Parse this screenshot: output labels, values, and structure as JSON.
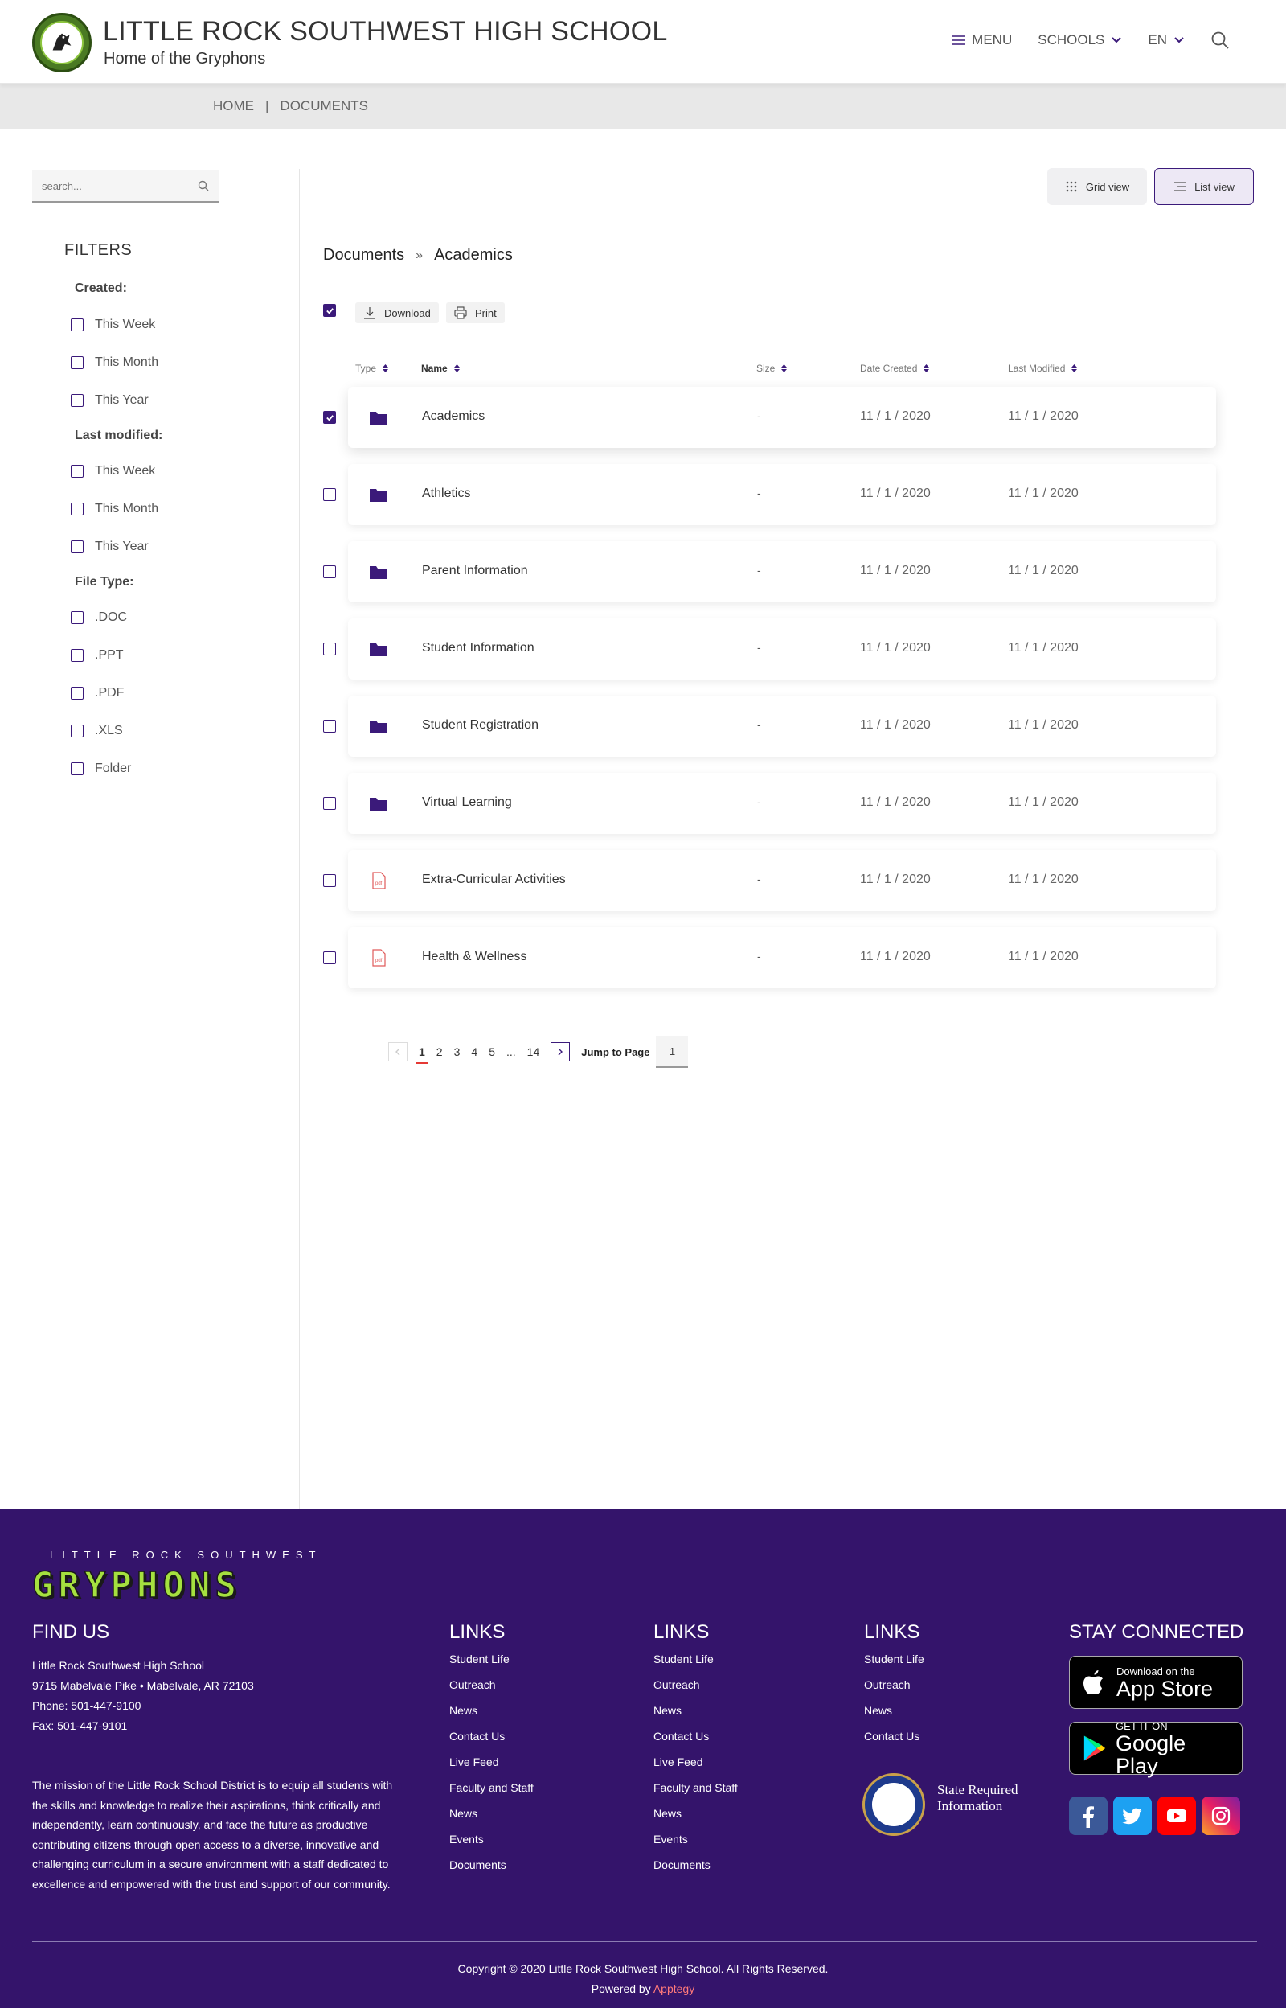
{
  "header": {
    "school_name": "LITTLE ROCK SOUTHWEST HIGH SCHOOL",
    "tagline": "Home of the Gryphons",
    "nav": {
      "menu": "MENU",
      "schools": "SCHOOLS",
      "language": "EN"
    }
  },
  "breadcrumb": {
    "home": "HOME",
    "separator": "|",
    "current": "DOCUMENTS"
  },
  "sidebar": {
    "search_placeholder": "search...",
    "filters_title": "FILTERS",
    "created": {
      "label": "Created:",
      "options": [
        "This Week",
        "This Month",
        "This Year"
      ]
    },
    "last_modified": {
      "label": "Last modified:",
      "options": [
        "This Week",
        "This Month",
        "This Year"
      ]
    },
    "file_type": {
      "label": "File Type:",
      "options": [
        ".DOC",
        ".PPT",
        ".PDF",
        ".XLS",
        "Folder"
      ]
    }
  },
  "views": {
    "grid": "Grid view",
    "list": "List view",
    "active": "list"
  },
  "doc_breadcrumb": {
    "root": "Documents",
    "separator": "»",
    "current": "Academics"
  },
  "actions": {
    "download": "Download",
    "print": "Print"
  },
  "table": {
    "headers": {
      "type": "Type",
      "name": "Name",
      "size": "Size",
      "created": "Date Created",
      "modified": "Last Modified"
    },
    "rows": [
      {
        "type": "folder",
        "name": "Academics",
        "size": "-",
        "created": "11 / 1 / 2020",
        "modified": "11 / 1 / 2020",
        "checked": true
      },
      {
        "type": "folder",
        "name": "Athletics",
        "size": "-",
        "created": "11 / 1 / 2020",
        "modified": "11 / 1 / 2020",
        "checked": false
      },
      {
        "type": "folder",
        "name": "Parent Information",
        "size": "-",
        "created": "11 / 1 / 2020",
        "modified": "11 / 1 / 2020",
        "checked": false
      },
      {
        "type": "folder",
        "name": "Student Information",
        "size": "-",
        "created": "11 / 1 / 2020",
        "modified": "11 / 1 / 2020",
        "checked": false
      },
      {
        "type": "folder",
        "name": "Student Registration",
        "size": "-",
        "created": "11 / 1 / 2020",
        "modified": "11 / 1 / 2020",
        "checked": false
      },
      {
        "type": "folder",
        "name": "Virtual Learning",
        "size": "-",
        "created": "11 / 1 / 2020",
        "modified": "11 / 1 / 2020",
        "checked": false
      },
      {
        "type": "pdf",
        "name": "Extra-Curricular Activities",
        "size": "-",
        "created": "11 / 1 / 2020",
        "modified": "11 / 1 / 2020",
        "checked": false
      },
      {
        "type": "pdf",
        "name": "Health & Wellness",
        "size": "-",
        "created": "11 / 1 / 2020",
        "modified": "11 / 1 / 2020",
        "checked": false
      }
    ]
  },
  "pagination": {
    "pages": [
      "1",
      "2",
      "3",
      "4",
      "5",
      "...",
      "14"
    ],
    "current": "1",
    "jump_label": "Jump to Page",
    "jump_value": "1"
  },
  "footer": {
    "brand_small": "LITTLE ROCK SOUTHWEST",
    "brand_big": "GRYPHONS",
    "find_us": {
      "title": "FIND US",
      "school": "Little Rock Southwest High School",
      "address": "9715 Mabelvale Pike • Mabelvale, AR 72103",
      "phone": "Phone:  501-447-9100",
      "fax": "Fax:  501-447-9101"
    },
    "mission": "The mission of the Little Rock School District is to equip all students with the skills and knowledge to realize their aspirations, think critically and independently, learn continuously, and face the future as productive contributing citizens through open access to a diverse, innovative and challenging curriculum in a secure environment with a staff dedicated to excellence and empowered with the trust and support of our community.",
    "links_col1": {
      "title": "LINKS",
      "items": [
        "Student Life",
        "Outreach",
        "News",
        "Contact Us",
        "Live Feed",
        "Faculty and Staff",
        "News",
        "Events",
        "Documents"
      ]
    },
    "links_col2": {
      "title": "LINKS",
      "items": [
        "Student Life",
        "Outreach",
        "News",
        "Contact Us",
        "Live Feed",
        "Faculty and Staff",
        "News",
        "Events",
        "Documents"
      ]
    },
    "links_col3": {
      "title": "LINKS",
      "items": [
        "Student Life",
        "Outreach",
        "News",
        "Contact Us"
      ]
    },
    "state_info": "State Required Information",
    "stay_connected": {
      "title": "STAY CONNECTED",
      "app_store_small": "Download on the",
      "app_store_big": "App Store",
      "google_small": "GET IT ON",
      "google_big": "Google Play"
    },
    "copyright": "Copyright © 2020 Little Rock Southwest High School. All Rights Reserved.",
    "powered_prefix": "Powered by",
    "powered_brand": "Apptegy"
  },
  "colors": {
    "primary": "#3b1a7a",
    "footer_bg": "#34146b",
    "accent_red": "#e53935",
    "pdf_red": "#e05a5a"
  }
}
